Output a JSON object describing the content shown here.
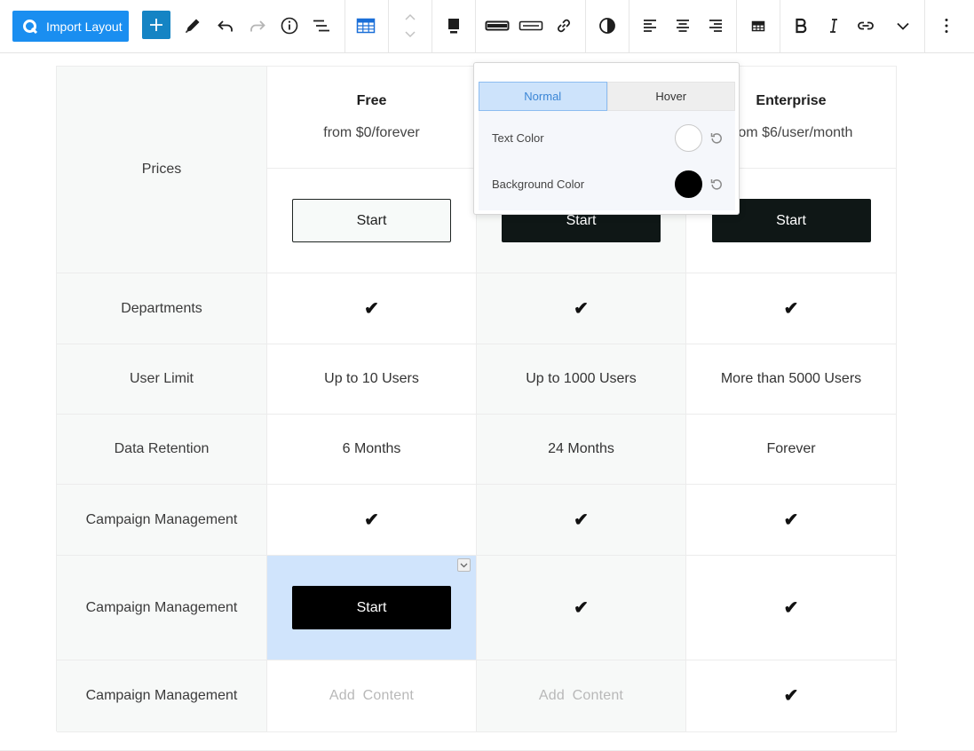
{
  "toolbar": {
    "import_label": "Import Layout",
    "icons": [
      "add-icon",
      "pen-icon",
      "undo-icon",
      "redo-icon",
      "info-icon",
      "list-view-icon",
      "table-icon",
      "move-up-down-icon",
      "color-fill-icon",
      "border-bold-icon",
      "border-thin-icon",
      "link-icon",
      "contrast-icon",
      "align-left-icon",
      "align-center-icon",
      "align-right-icon",
      "table-settings-icon",
      "bold-icon",
      "italic-icon",
      "inline-link-icon",
      "more-rich-text-icon",
      "options-icon"
    ]
  },
  "table": {
    "row_headers": [
      "Prices",
      "Departments",
      "User Limit",
      "Data Retention",
      "Campaign Management",
      "Campaign Management",
      "Campaign Management"
    ],
    "plans": [
      {
        "name": "Free",
        "price": "from $0/forever",
        "button": "Start"
      },
      {
        "name": "",
        "price": "",
        "button": "Start"
      },
      {
        "name": "Enterprise",
        "price": "from $6/user/month",
        "button": "Start"
      }
    ],
    "user_limit": [
      "Up to 10 Users",
      "Up to 1000 Users",
      "More than 5000 Users"
    ],
    "data_retention": [
      "6 Months",
      "24 Months",
      "Forever"
    ],
    "selected_button": "Start",
    "add_content": "Add  Content",
    "check": "✔"
  },
  "popover": {
    "tab_normal": "Normal",
    "tab_hover": "Hover",
    "text_color_label": "Text Color",
    "text_color": "#ffffff",
    "bg_color_label": "Background Color",
    "bg_color": "#000000"
  },
  "colors": {
    "accent": "#1a8ef0",
    "add_button": "#1584c4",
    "selected_cell": "#d0e4fc",
    "dark_button": "#0f1716"
  }
}
